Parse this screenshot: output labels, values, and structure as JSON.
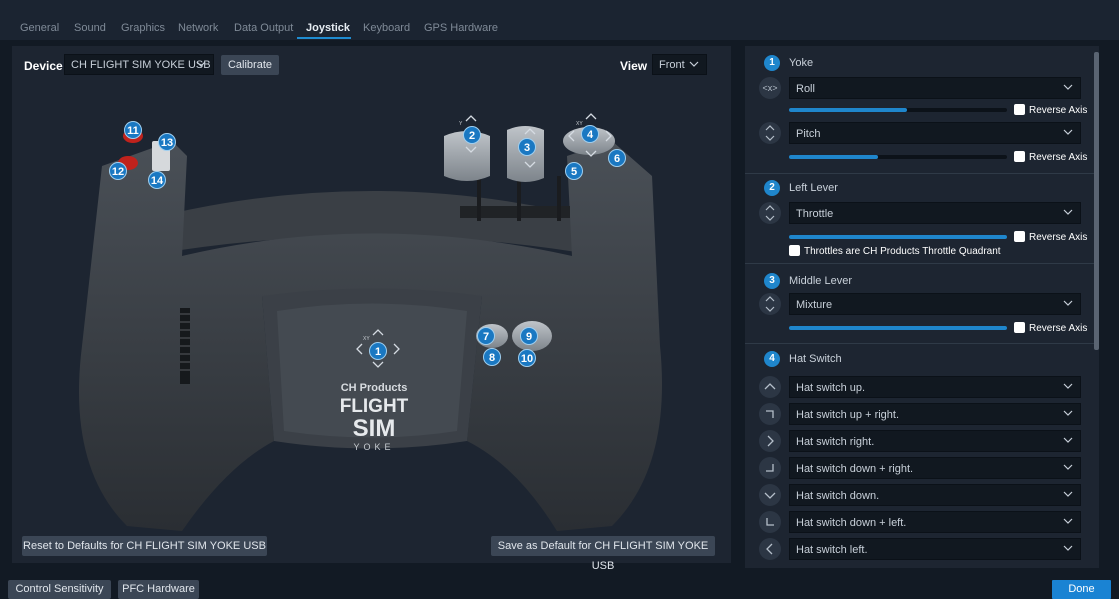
{
  "tabs": [
    "General",
    "Sound",
    "Graphics",
    "Network",
    "Data Output",
    "Joystick",
    "Keyboard",
    "GPS Hardware"
  ],
  "active_tab": "Joystick",
  "device": {
    "label": "Device",
    "value": "CH FLIGHT SIM YOKE USB",
    "calibrate": "Calibrate"
  },
  "view": {
    "label": "View",
    "value": "Front"
  },
  "image_brand": {
    "line1": "CH Products",
    "line2": "FLIGHT",
    "line3": "SIM",
    "line4": "YOKE"
  },
  "badges": [
    "1",
    "2",
    "3",
    "4",
    "5",
    "6",
    "7",
    "8",
    "9",
    "10",
    "11",
    "12",
    "13",
    "14"
  ],
  "hat_axis_labels": {
    "b1": "XY",
    "b2": "Y",
    "b4": "XY"
  },
  "left_buttons": {
    "reset": "Reset to Defaults for CH FLIGHT SIM YOKE USB",
    "save": "Save as Default for CH FLIGHT SIM YOKE USB"
  },
  "right": {
    "reverse_label": "Reverse Axis",
    "yoke": {
      "number": "1",
      "title": "Yoke",
      "roll": {
        "value": "Roll",
        "icon_text": "<x>",
        "fill_pct": 54
      },
      "pitch": {
        "value": "Pitch",
        "fill_pct": 41
      }
    },
    "left_lever": {
      "number": "2",
      "title": "Left Lever",
      "value": "Throttle",
      "fill_pct": 100,
      "quadrant_label": "Throttles are CH Products Throttle Quadrant"
    },
    "middle_lever": {
      "number": "3",
      "title": "Middle Lever",
      "value": "Mixture",
      "fill_pct": 100
    },
    "hat": {
      "number": "4",
      "title": "Hat Switch",
      "items": [
        {
          "icon": "chevron-up-icon",
          "value": "Hat switch up."
        },
        {
          "icon": "corner-up-right-icon",
          "value": "Hat switch up + right."
        },
        {
          "icon": "chevron-right-icon",
          "value": "Hat switch right."
        },
        {
          "icon": "corner-down-right-icon",
          "value": "Hat switch down + right."
        },
        {
          "icon": "chevron-down-icon",
          "value": "Hat switch down."
        },
        {
          "icon": "corner-down-left-icon",
          "value": "Hat switch down + left."
        },
        {
          "icon": "chevron-left-icon",
          "value": "Hat switch left."
        }
      ]
    }
  },
  "bottom": {
    "control_sensitivity": "Control Sensitivity",
    "pfc_hardware": "PFC Hardware",
    "done": "Done"
  },
  "colors": {
    "accent": "#1f86cc",
    "panel": "#1d2531",
    "background": "#121a24"
  }
}
